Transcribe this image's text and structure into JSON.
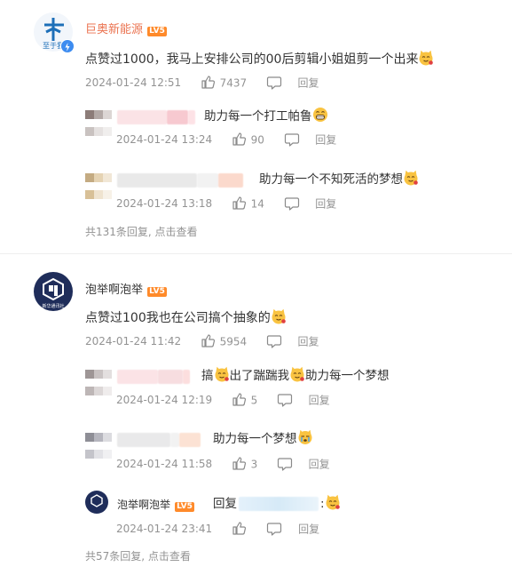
{
  "thread1": {
    "username": "巨奥新能源",
    "level": "LV5",
    "avatar_caption": "至于我",
    "text": "点赞过1000，我马上安排公司的00后剪辑小姐姐剪一个出来",
    "time": "2024-01-24 12:51",
    "likes": "7437",
    "reply_label": "回复",
    "replies": [
      {
        "text": "助力每一个打工帕鲁",
        "time": "2024-01-24 13:24",
        "likes": "90",
        "reply_label": "回复"
      },
      {
        "text": "助力每一个不知死活的梦想",
        "time": "2024-01-24 13:18",
        "likes": "14",
        "reply_label": "回复"
      }
    ],
    "more": "共131条回复, 点击查看"
  },
  "thread2": {
    "username": "泡举啊泡举",
    "level": "LV5",
    "avatar_caption": "新华通讯社",
    "text": "点赞过100我也在公司搞个抽象的",
    "time": "2024-01-24 11:42",
    "likes": "5954",
    "reply_label": "回复",
    "replies": [
      {
        "text_a": "搞",
        "text_b": "出了踹踹我",
        "text_c": "助力每一个梦想",
        "time": "2024-01-24 12:19",
        "likes": "5",
        "reply_label": "回复"
      },
      {
        "text": "助力每一个梦想",
        "time": "2024-01-24 11:58",
        "likes": "3",
        "reply_label": "回复"
      },
      {
        "username": "泡举啊泡举",
        "level": "LV5",
        "text_prefix": "回复",
        "text_suffix": ":",
        "time": "2024-01-24 23:41",
        "reply_label": "回复"
      }
    ],
    "more": "共57条回复, 点击查看"
  },
  "icons": [
    "thumb-up-icon",
    "comment-icon",
    "verified-badge-icon",
    "cat-emoji-icon",
    "grin-emoji-icon",
    "cry-emoji-icon"
  ],
  "colors": {
    "username_orange": "#eb7350",
    "meta_gray": "#939393",
    "level_badge": "#ff8a2a",
    "verified_blue": "#3d8cf0"
  }
}
